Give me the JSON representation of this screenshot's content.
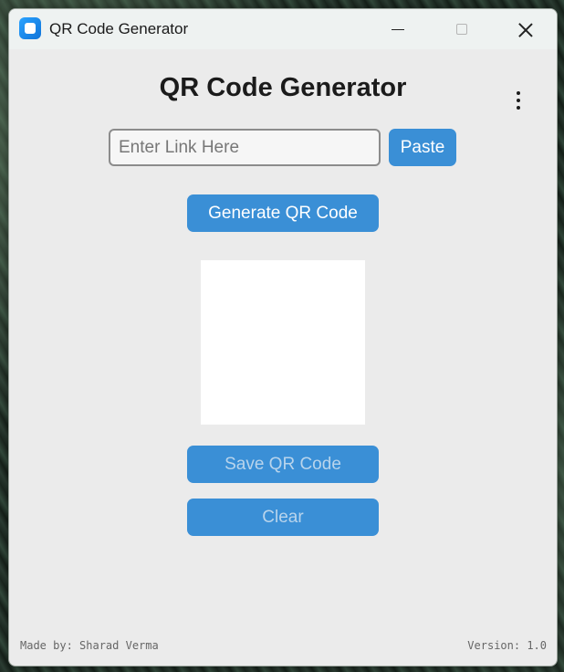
{
  "window": {
    "title": "QR Code Generator",
    "controls": {
      "minimize": "minimize-icon",
      "maximize": "maximize-icon",
      "close": "close-icon"
    }
  },
  "app": {
    "heading": "QR Code Generator",
    "menu_icon": "more-vertical-icon",
    "link_input": {
      "value": "",
      "placeholder": "Enter Link Here"
    },
    "paste_label": "Paste",
    "generate_label": "Generate QR Code",
    "save_label": "Save QR Code",
    "clear_label": "Clear"
  },
  "footer": {
    "credit": "Made by: Sharad Verma",
    "version": "Version: 1.0"
  },
  "colors": {
    "accent": "#3a8fd6",
    "window_bg": "#ebebeb",
    "titlebar_bg": "#eef2f1",
    "disabled_text": "#b8d4ec"
  }
}
